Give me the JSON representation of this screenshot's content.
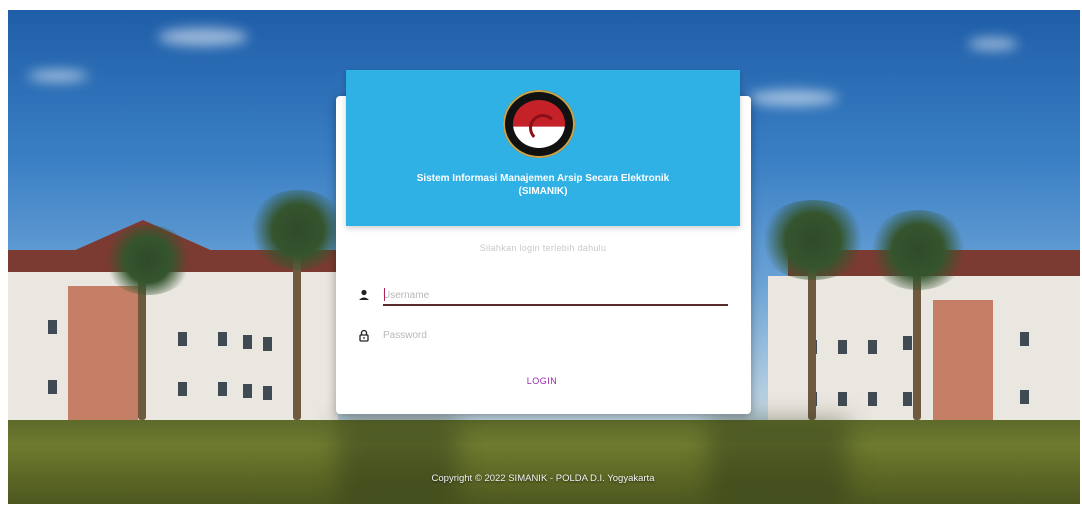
{
  "app": {
    "title_line1": "Sistem Informasi Manajemen Arsip Secara Elektronik",
    "title_line2": "(SIMANIK)",
    "logo": "polda-diy-emblem"
  },
  "login": {
    "welcome": "Silahkan login terlebih dahulu",
    "username_placeholder": "Username",
    "password_placeholder": "Password",
    "button_label": "LOGIN",
    "username_icon": "user-icon",
    "password_icon": "lock-icon"
  },
  "footer": {
    "copyright": "Copyright © 2022 SIMANIK - POLDA D.I. Yogyakarta"
  },
  "colors": {
    "header": "#2fb1e6",
    "button_text": "#9c27b0",
    "input_underline": "#5a2a2f"
  }
}
